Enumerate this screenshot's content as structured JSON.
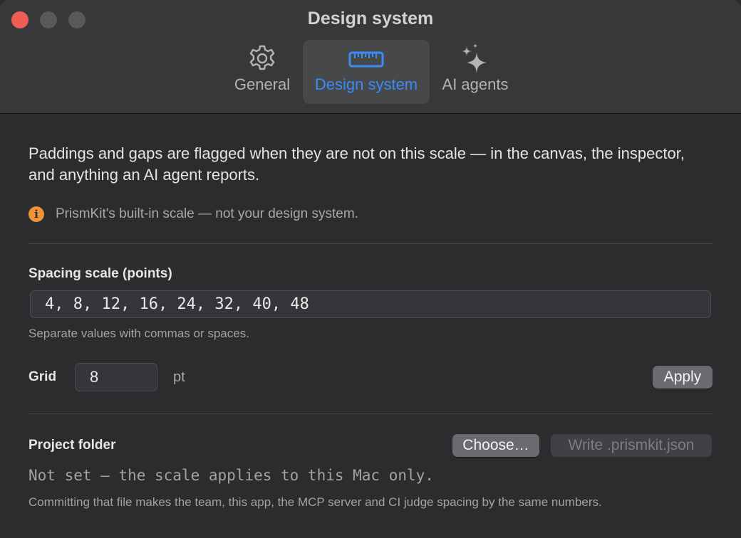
{
  "window": {
    "title": "Design system",
    "traffic_lights": {
      "close_color": "#ee5e57",
      "inactive_color": "#58595b"
    }
  },
  "tabs": [
    {
      "label": "General",
      "icon": "gear-icon",
      "selected": false
    },
    {
      "label": "Design system",
      "icon": "ruler-icon",
      "selected": true
    },
    {
      "label": "AI agents",
      "icon": "sparkles-icon",
      "selected": false
    }
  ],
  "accent_color": "#3a8cf6",
  "intro_text": "Paddings and gaps are flagged when they are not on this scale — in the canvas, the inspector, and anything an AI agent reports.",
  "notice": {
    "icon": "info-icon",
    "text": "PrismKit's built-in scale — not your design system.",
    "color": "#f0923a"
  },
  "spacing": {
    "label": "Spacing scale (points)",
    "value": "4, 8, 12, 16, 24, 32, 40, 48",
    "hint": "Separate values with commas or spaces."
  },
  "grid": {
    "label": "Grid",
    "value": "8",
    "unit": "pt",
    "apply_label": "Apply"
  },
  "project_folder": {
    "label": "Project folder",
    "choose_label": "Choose…",
    "write_label": "Write .prismkit.json",
    "status": "Not set — the scale applies to this Mac only.",
    "hint": "Committing that file makes the team, this app, the MCP server and CI judge spacing by the same numbers."
  }
}
